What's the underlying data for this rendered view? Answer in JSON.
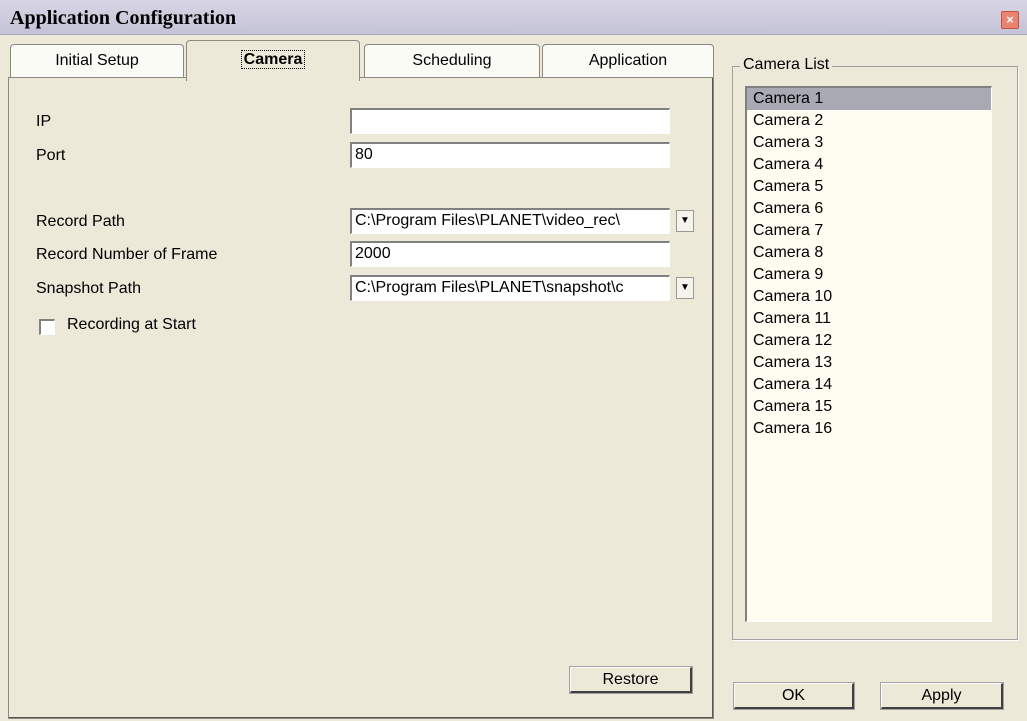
{
  "window": {
    "title": "Application Configuration",
    "close_glyph": "×"
  },
  "tabs": [
    {
      "label": "Initial Setup",
      "active": false
    },
    {
      "label": "Camera",
      "active": true
    },
    {
      "label": "Scheduling",
      "active": false
    },
    {
      "label": "Application",
      "active": false
    }
  ],
  "camera": {
    "ip_label": "IP",
    "ip_value": "",
    "port_label": "Port",
    "port_value": "80",
    "record_path_label": "Record Path",
    "record_path_value": "C:\\Program Files\\PLANET\\video_rec\\",
    "record_frames_label": "Record Number of Frame",
    "record_frames_value": "2000",
    "snapshot_path_label": "Snapshot Path",
    "snapshot_path_value": "C:\\Program Files\\PLANET\\snapshot\\c",
    "recording_at_start_label": "Recording at Start",
    "recording_at_start_checked": false,
    "restore_label": "Restore",
    "dropdown_glyph": "▼"
  },
  "camera_list": {
    "title": "Camera List",
    "selected": "Camera 1",
    "items": [
      "Camera 1",
      "Camera 2",
      "Camera 3",
      "Camera 4",
      "Camera 5",
      "Camera 6",
      "Camera 7",
      "Camera 8",
      "Camera 9",
      "Camera 10",
      "Camera 11",
      "Camera 12",
      "Camera 13",
      "Camera 14",
      "Camera 15",
      "Camera 16"
    ]
  },
  "buttons": {
    "ok_label": "OK",
    "apply_label": "Apply"
  }
}
